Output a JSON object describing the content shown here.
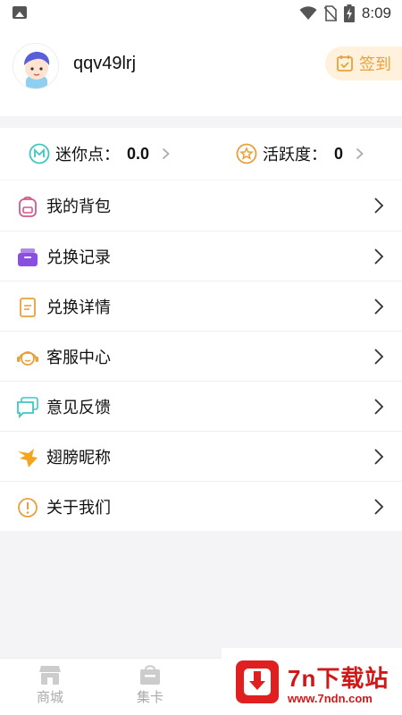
{
  "status_bar": {
    "time": "8:09",
    "icons": [
      "image-icon",
      "wifi-icon",
      "no-sim-icon",
      "battery-charging-icon"
    ]
  },
  "profile": {
    "username": "qqv49lrj",
    "avatar_icon": "boy-avatar-icon",
    "signin_label": "签到",
    "signin_icon": "calendar-check-icon"
  },
  "points": {
    "mini_label": "迷你点：",
    "mini_value": "0.0",
    "activity_label": "活跃度：",
    "activity_value": "0"
  },
  "menu": {
    "items": [
      {
        "label": "我的背包",
        "icon": "backpack-icon"
      },
      {
        "label": "兑换记录",
        "icon": "archive-box-icon"
      },
      {
        "label": "兑换详情",
        "icon": "document-icon"
      },
      {
        "label": "客服中心",
        "icon": "headset-icon"
      },
      {
        "label": "意见反馈",
        "icon": "chat-bubbles-icon"
      },
      {
        "label": "翅膀昵称",
        "icon": "wing-icon"
      },
      {
        "label": "关于我们",
        "icon": "info-circle-icon"
      }
    ]
  },
  "tab_bar": {
    "tabs": [
      {
        "label": "商城",
        "icon": "shop-icon"
      },
      {
        "label": "集卡",
        "icon": "card-bag-icon"
      }
    ]
  },
  "watermark": {
    "title": "7n下载站",
    "url": "www.7ndn.com"
  },
  "colors": {
    "accent_orange": "#e8a13a",
    "signin_bg": "#fff1dc",
    "watermark_red": "#d01818",
    "page_bg": "#f4f4f6"
  }
}
